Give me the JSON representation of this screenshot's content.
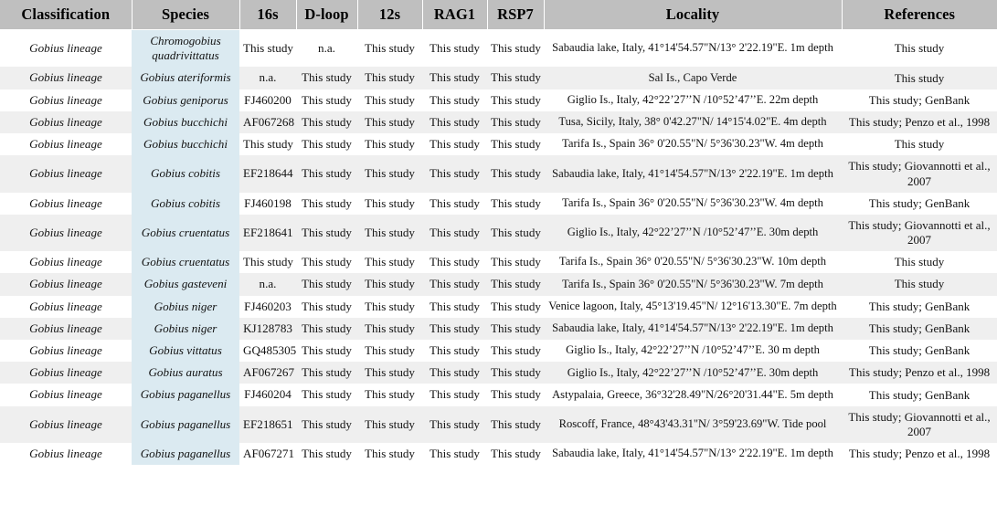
{
  "table": {
    "columns": [
      {
        "key": "classification",
        "label": "Classification"
      },
      {
        "key": "species",
        "label": "Species"
      },
      {
        "key": "m16s",
        "label": "16s"
      },
      {
        "key": "dloop",
        "label": "D-loop"
      },
      {
        "key": "m12s",
        "label": "12s"
      },
      {
        "key": "rag1",
        "label": "RAG1"
      },
      {
        "key": "rsp7",
        "label": "RSP7"
      },
      {
        "key": "locality",
        "label": "Locality"
      },
      {
        "key": "references",
        "label": "References"
      }
    ],
    "colors": {
      "header_background": "#bfbfbf",
      "species_column_background": "#dbeaf1",
      "row_stripe_background": "#efefef",
      "row_background": "#ffffff",
      "text": "#111111"
    },
    "rows": [
      {
        "classification": "Gobius lineage",
        "species": "Chromogobius quadrivittatus",
        "m16s": "This study",
        "dloop": "n.a.",
        "m12s": "This study",
        "rag1": "This study",
        "rsp7": "This study",
        "locality": "Sabaudia lake, Italy, 41°14'54.57\"N/13° 2'22.19\"E. 1m depth",
        "references": "This study"
      },
      {
        "classification": "Gobius lineage",
        "species": "Gobius ateriformis",
        "m16s": "n.a.",
        "dloop": "This study",
        "m12s": "This study",
        "rag1": "This study",
        "rsp7": "This study",
        "locality": "Sal Is., Capo Verde",
        "references": "This study"
      },
      {
        "classification": "Gobius lineage",
        "species": "Gobius geniporus",
        "m16s": "FJ460200",
        "dloop": "This study",
        "m12s": "This study",
        "rag1": "This study",
        "rsp7": "This study",
        "locality": "Giglio Is., Italy, 42°22’27’’N /10°52’47’’E. 22m depth",
        "references": "This study; GenBank"
      },
      {
        "classification": "Gobius lineage",
        "species": "Gobius bucchichi",
        "m16s": "AF067268",
        "dloop": "This study",
        "m12s": "This study",
        "rag1": "This study",
        "rsp7": "This study",
        "locality": "Tusa, Sicily, Italy,  38° 0'42.27\"N/ 14°15'4.02\"E. 4m depth",
        "references": "This study; Penzo et al., 1998"
      },
      {
        "classification": "Gobius lineage",
        "species": "Gobius bucchichi",
        "m16s": "This study",
        "dloop": "This study",
        "m12s": "This study",
        "rag1": "This study",
        "rsp7": "This study",
        "locality": "Tarifa Is., Spain  36° 0'20.55\"N/  5°36'30.23\"W. 4m depth",
        "references": "This study"
      },
      {
        "classification": "Gobius lineage",
        "species": "Gobius cobitis",
        "m16s": "EF218644",
        "dloop": "This study",
        "m12s": "This study",
        "rag1": "This study",
        "rsp7": "This study",
        "locality": "Sabaudia lake, Italy, 41°14'54.57\"N/13° 2'22.19\"E. 1m depth",
        "references": "This study; Giovannotti et al., 2007"
      },
      {
        "classification": "Gobius lineage",
        "species": "Gobius cobitis",
        "m16s": "FJ460198",
        "dloop": "This study",
        "m12s": "This study",
        "rag1": "This study",
        "rsp7": "This study",
        "locality": "Tarifa Is., Spain  36° 0'20.55\"N/  5°36'30.23\"W. 4m depth",
        "references": "This study;  GenBank"
      },
      {
        "classification": "Gobius lineage",
        "species": "Gobius cruentatus",
        "m16s": "EF218641",
        "dloop": "This study",
        "m12s": "This study",
        "rag1": "This study",
        "rsp7": "This study",
        "locality": "Giglio Is., Italy, 42°22’27’’N /10°52’47’’E. 30m depth",
        "references": "This study; Giovannotti et al., 2007"
      },
      {
        "classification": "Gobius lineage",
        "species": "Gobius cruentatus",
        "m16s": "This study",
        "dloop": "This study",
        "m12s": "This study",
        "rag1": "This study",
        "rsp7": "This study",
        "locality": "Tarifa Is., Spain  36° 0'20.55\"N/  5°36'30.23\"W. 10m depth",
        "references": "This study"
      },
      {
        "classification": "Gobius lineage",
        "species": "Gobius gasteveni",
        "m16s": "n.a.",
        "dloop": "This study",
        "m12s": "This study",
        "rag1": "This study",
        "rsp7": "This study",
        "locality": "Tarifa Is., Spain  36° 0'20.55\"N/  5°36'30.23\"W. 7m depth",
        "references": "This study"
      },
      {
        "classification": "Gobius lineage",
        "species": "Gobius niger",
        "m16s": "FJ460203",
        "dloop": "This study",
        "m12s": "This study",
        "rag1": "This study",
        "rsp7": "This study",
        "locality": "Venice lagoon, Italy,  45°13'19.45\"N/ 12°16'13.30\"E. 7m depth",
        "references": "This study;  GenBank"
      },
      {
        "classification": "Gobius lineage",
        "species": "Gobius niger",
        "m16s": "KJ128783",
        "dloop": "This study",
        "m12s": "This study",
        "rag1": "This study",
        "rsp7": "This study",
        "locality": "Sabaudia lake, Italy, 41°14'54.57\"N/13° 2'22.19\"E. 1m depth",
        "references": "This study;  GenBank"
      },
      {
        "classification": "Gobius lineage",
        "species": "Gobius vittatus",
        "m16s": "GQ485305",
        "dloop": "This study",
        "m12s": "This study",
        "rag1": "This study",
        "rsp7": "This study",
        "locality": "Giglio Is., Italy, 42°22’27’’N /10°52’47’’E. 30 m depth",
        "references": "This study;  GenBank"
      },
      {
        "classification": "Gobius lineage",
        "species": "Gobius auratus",
        "m16s": "AF067267",
        "dloop": "This study",
        "m12s": "This study",
        "rag1": "This study",
        "rsp7": "This study",
        "locality": "Giglio Is., Italy, 42°22’27’’N /10°52’47’’E. 30m depth",
        "references": "This study; Penzo et al., 1998"
      },
      {
        "classification": "Gobius lineage",
        "species": "Gobius paganellus",
        "m16s": "FJ460204",
        "dloop": "This study",
        "m12s": "This study",
        "rag1": "This study",
        "rsp7": "This study",
        "locality": "Astypalaia, Greece,  36°32'28.49\"N/26°20'31.44\"E. 5m depth",
        "references": "This study;  GenBank"
      },
      {
        "classification": "Gobius lineage",
        "species": "Gobius paganellus",
        "m16s": "EF218651",
        "dloop": "This study",
        "m12s": "This study",
        "rag1": "This study",
        "rsp7": "This study",
        "locality": "Roscoff, France, 48°43'43.31\"N/ 3°59'23.69\"W. Tide pool",
        "references": "This study; Giovannotti et al., 2007"
      },
      {
        "classification": "Gobius lineage",
        "species": "Gobius paganellus",
        "m16s": "AF067271",
        "dloop": "This study",
        "m12s": "This study",
        "rag1": "This study",
        "rsp7": "This study",
        "locality": "Sabaudia lake, Italy, 41°14'54.57\"N/13° 2'22.19\"E. 1m depth",
        "references": "This study; Penzo et al., 1998"
      }
    ]
  }
}
